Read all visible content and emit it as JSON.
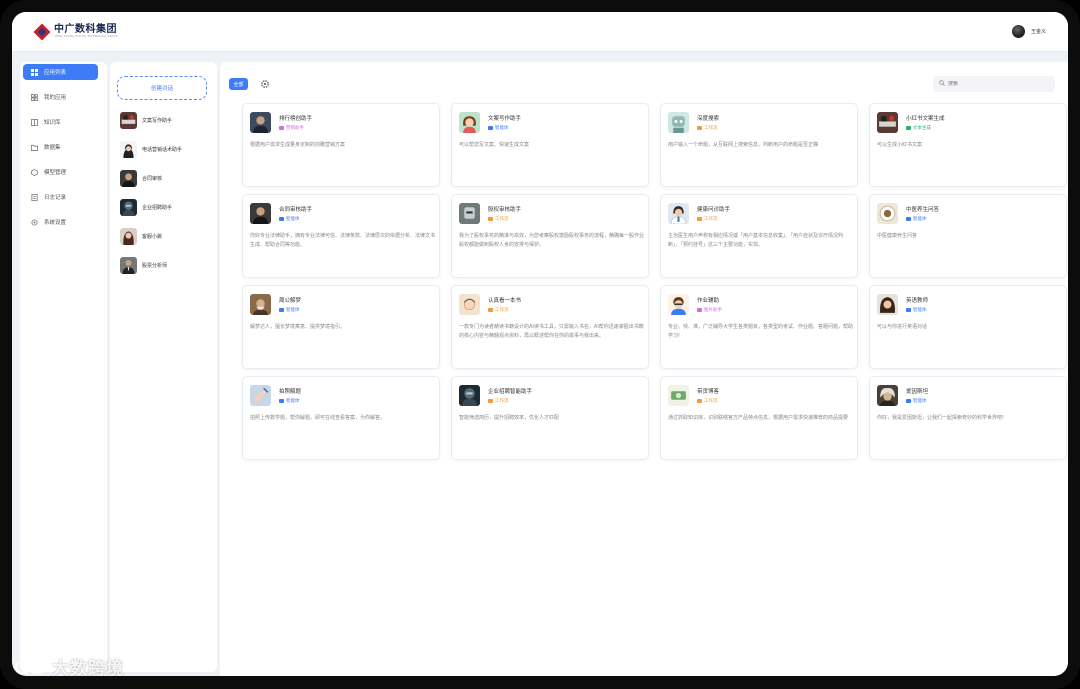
{
  "header": {
    "logo_title": "中广数科集团",
    "logo_subtitle": "CHINA GUANG DIGITAL TECHNOLOGY GROUP",
    "user_name": "王金义"
  },
  "menu": {
    "items": [
      {
        "label": "应用列表",
        "icon": "grid-icon",
        "active": true
      },
      {
        "label": "我的应用",
        "icon": "apps-icon",
        "active": false
      },
      {
        "label": "知识库",
        "icon": "book-icon",
        "active": false
      },
      {
        "label": "数据集",
        "icon": "dataset-icon",
        "active": false
      },
      {
        "label": "模型管理",
        "icon": "model-icon",
        "active": false
      },
      {
        "label": "日志记录",
        "icon": "log-icon",
        "active": false
      },
      {
        "label": "系统设置",
        "icon": "settings-icon",
        "active": false
      }
    ]
  },
  "conversations": {
    "new_label": "创建对话",
    "items": [
      {
        "name": "文案写作助手",
        "avatar": "office-desk"
      },
      {
        "name": "电话营销话术助手",
        "avatar": "woman-bob"
      },
      {
        "name": "合同审核",
        "avatar": "man-dark"
      },
      {
        "name": "企业招聘助手",
        "avatar": "robot-dark"
      },
      {
        "name": "客服小跳",
        "avatar": "woman-long-hair"
      },
      {
        "name": "股票分析师",
        "avatar": "man-suit"
      }
    ]
  },
  "toolbar": {
    "filter_all": "全部",
    "search_placeholder": "搜索"
  },
  "cards": [
    {
      "title": "排行榜创助手",
      "tag": "营销助手",
      "tag_color": "#d46ee0",
      "desc": "根据用户需求生成量身定制的前瞻营销方案",
      "avatar": "man-portrait"
    },
    {
      "title": "文案写作助手",
      "tag": "智能体",
      "tag_color": "#3d7bf7",
      "desc": "可以帮您写文案、快速生成文案",
      "avatar": "cartoon-girl"
    },
    {
      "title": "深度搜索",
      "tag": "工作流",
      "tag_color": "#f29b38",
      "desc": "用户输入一个命题，从互联网上搜索信息，判断用户的命题是否正确",
      "avatar": "robot-teal"
    },
    {
      "title": "小红书文案生成",
      "tag": "文本生成",
      "tag_color": "#2fb36b",
      "desc": "可以生成小红书文案",
      "avatar": "office-desk"
    },
    {
      "title": "合同审核助手",
      "tag": "智能体",
      "tag_color": "#3d7bf7",
      "desc": "你好专业法律助手，拥有专业法律可信、法律条款、法律层次的依据分析、法律文书生成、帮助合同等功能。",
      "avatar": "man-dark"
    },
    {
      "title": "股权审核助手",
      "tag": "工作流",
      "tag_color": "#f29b38",
      "desc": "我为了股权事务的精准与高效，为您考察股权激励股权事务的流程，精确每一股作业股权都能做到股权人身的安排与保护。",
      "avatar": "robot-gray"
    },
    {
      "title": "健康问诊助手",
      "tag": "工作流",
      "tag_color": "#f29b38",
      "desc": "主治医生用户声称有相应情况或「用户基本信息收集」、「用户症状及诊疗情况判断」、「预约挂号」这三个主要功能，实现。",
      "avatar": "doctor"
    },
    {
      "title": "中医养生问答",
      "tag": "智能体",
      "tag_color": "#3d7bf7",
      "desc": "中医健康养生问答",
      "avatar": "herb-plate"
    },
    {
      "title": "周公解梦",
      "tag": "智能体",
      "tag_color": "#3d7bf7",
      "desc": "解梦达人，擅长梦境寓意、提供梦境指引。",
      "avatar": "old-man"
    },
    {
      "title": "认真看一本书",
      "tag": "工作流",
      "tag_color": "#f29b38",
      "desc": "一款专门为读者精读书籍设计的AI读书工具，只需输入书名，AI帮你迅速掌握出书籍的核心内容与精髓观点资料，再以概述帮你在你的故事与我出来。",
      "avatar": "man-cartoon"
    },
    {
      "title": "作业辅助",
      "tag": "图片助手",
      "tag_color": "#d46ee0",
      "desc": "专业、快、准，广泛辅导大学生各类题目，各类型的考试、作业题、答题问题，帮助学习!",
      "avatar": "boy-cartoon"
    },
    {
      "title": "英语教师",
      "tag": "智能体",
      "tag_color": "#3d7bf7",
      "desc": "可以与你进行英语对话",
      "avatar": "woman-curly"
    },
    {
      "title": "拍照解题",
      "tag": "智能体",
      "tag_color": "#3d7bf7",
      "desc": "拍照上传数学题，帮你解题，即可在线查看答案，为你解答。",
      "avatar": "hand-pen"
    },
    {
      "title": "企业招聘智能助手",
      "tag": "工作流",
      "tag_color": "#f29b38",
      "desc": "智能筛选简历，提升招聘效率，优化人才匹配",
      "avatar": "robot-dark"
    },
    {
      "title": "带货博客",
      "tag": "工作流",
      "tag_color": "#f29b38",
      "desc": "通过抓取知识库，识别联络官方产品特点信息，根据用户需求快速推荐的商品提要",
      "avatar": "money"
    },
    {
      "title": "爱因斯坦",
      "tag": "智能体",
      "tag_color": "#3d7bf7",
      "desc": "你好，我是爱因斯坦，让我们一起探索奇妙的科学世界吧!",
      "avatar": "einstein"
    }
  ],
  "watermark": {
    "text": "大数跨境"
  },
  "colors": {
    "accent": "#3d7bf7",
    "workflow": "#f29b38",
    "agent": "#3d7bf7",
    "image": "#d46ee0",
    "text_gen": "#2fb36b"
  }
}
